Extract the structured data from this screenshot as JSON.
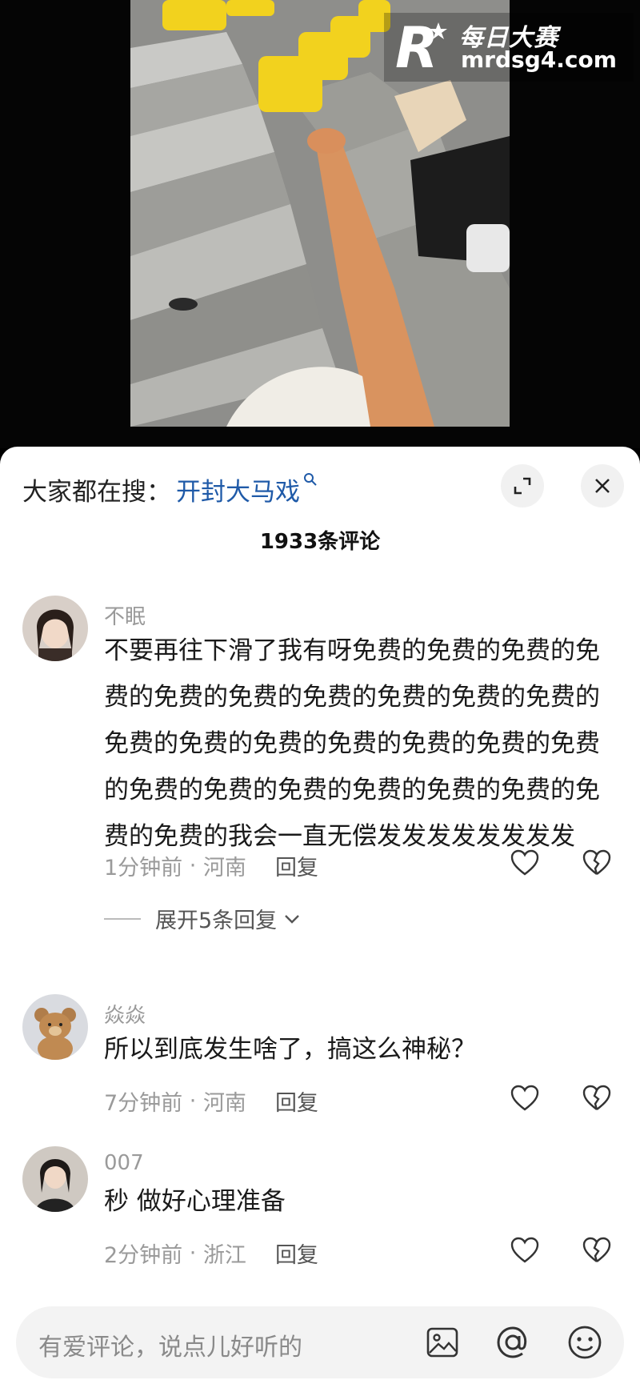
{
  "watermark": {
    "brand_letter": "R",
    "brand_name": "每日大赛",
    "url": "mrdsg4.com"
  },
  "sheet": {
    "search_prefix": "大家都在搜：",
    "search_term": "开封大马戏",
    "comment_count_title": "1933条评论",
    "expand_icon": "expand-icon",
    "close_icon": "close-icon"
  },
  "comments": [
    {
      "username": "不眠",
      "text": "不要再往下滑了我有呀免费的免费的免费的免费的免费的免费的免费的免费的免费的免费的免费的免费的免费的免费的免费的免费的免费的免费的免费的免费的免费的免费的免费的免费的免费的我会一直无偿发发发发发发发发",
      "time": "1分钟前",
      "location": "河南",
      "reply_label": "回复",
      "expand_replies": "展开5条回复"
    },
    {
      "username": "焱焱",
      "text": "所以到底发生啥了，搞这么神秘？",
      "time": "7分钟前",
      "location": "河南",
      "reply_label": "回复"
    },
    {
      "username": "007",
      "text": "秒 做好心理准备",
      "time": "2分钟前",
      "location": "浙江",
      "reply_label": "回复"
    }
  ],
  "input_bar": {
    "placeholder": "有爱评论，说点儿好听的",
    "icons": [
      "image-icon",
      "at-icon",
      "emoji-icon"
    ]
  },
  "colors": {
    "link_blue": "#1f5aa8",
    "muted_gray": "#9a9a9a",
    "seat_yellow": "#f2d21e"
  }
}
